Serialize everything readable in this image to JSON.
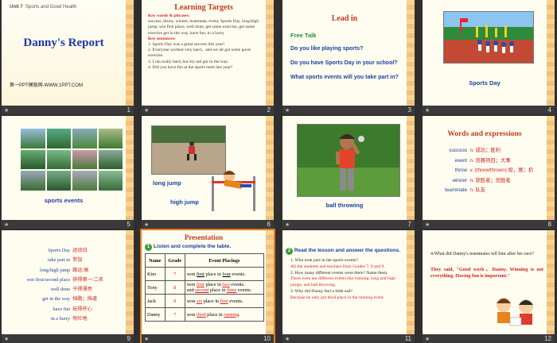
{
  "slides": {
    "s1": {
      "unit": "Unit 7",
      "unit_sub": "Sports and Good Health",
      "title": "Danny's Report",
      "credit": "第一PPT模板网-WWW.1PPT.COM",
      "num": "1"
    },
    "s2": {
      "title": "Learning Targets",
      "kw_label": "Key words & phrases:",
      "kw": "success, throw, winner, teammate, event, Sports Day, long/high jump, win first place, well done, get some exercise, get some exercise get in the way, have fun, in a hurry",
      "ks_label": "Key sentences:",
      "ks": [
        "1. Sports Day was a great success this year!",
        "2. Everyone worked very hard，and we all got some good exercise.",
        "3. I ran really hard, but my tail got in the way.",
        "4. Did you have fun at the sports meet last year?"
      ],
      "num": "2"
    },
    "s3": {
      "title": "Lead in",
      "free": "Free Talk",
      "q1": "Do you like playing sports?",
      "q2": "Do you have Sports Day in your school?",
      "q3": "What  sports events will you take part in?",
      "num": "3"
    },
    "s4": {
      "caption": "Sports  Day",
      "num": "4"
    },
    "s5": {
      "caption": "sports events",
      "num": "5"
    },
    "s6": {
      "c1": "long jump",
      "c2": "high jump",
      "num": "6"
    },
    "s7": {
      "caption": "ball throwing",
      "num": "7"
    },
    "s8": {
      "title": "Words and expressions",
      "rows": [
        {
          "en": "success",
          "zh": "n. 成功；胜利"
        },
        {
          "en": "event",
          "zh": "n. 竞赛项目；大事"
        },
        {
          "en": "throw",
          "zh": "v. (threw/thrown) 投，掷；扔"
        },
        {
          "en": "winner",
          "zh": "n. 获胜者；优胜者"
        },
        {
          "en": "teammate",
          "zh": "n. 队友"
        }
      ],
      "num": "8"
    },
    "s9": {
      "rows": [
        {
          "en": "Sports Day",
          "zh": "运动日"
        },
        {
          "en": "take part in",
          "zh": "参加"
        },
        {
          "en": "long/high jump",
          "zh": "跳远/高"
        },
        {
          "en": "win first/second place",
          "zh": "获得第一/二名"
        },
        {
          "en": "well done",
          "zh": "干得漂亮"
        },
        {
          "en": "get in the way",
          "zh": "挡路；挡道"
        },
        {
          "en": "have fun",
          "zh": "玩得开心"
        },
        {
          "en": "in a hurry",
          "zh": "匆忙地"
        }
      ],
      "num": "9"
    },
    "s10": {
      "title": "Presentation",
      "badge": "1",
      "instruction": "Listen and complete the table.",
      "headers": [
        "Name",
        "Grade",
        "Event Placings"
      ],
      "rows": [
        {
          "name": "Kim",
          "grade": "7",
          "l1": "won",
          "u1": "first",
          "l2": "place in",
          "u2": "four",
          "l3": "events."
        },
        {
          "name": "Tony",
          "grade": "8",
          "l1": "won",
          "u1": "first",
          "l2": "place in",
          "u2": "two",
          "l3": "events.",
          "m1": "and",
          "u3": "second",
          "m2": "place in",
          "u4": "three",
          "m3": "events."
        },
        {
          "name": "Jack",
          "grade": "9",
          "l1": "won",
          "u1": "six",
          "l2": "place in",
          "u2": "first",
          "l3": "events."
        },
        {
          "name": "Danny",
          "grade": "7",
          "l1": "won",
          "u1": "third",
          "l2": "place in",
          "u2": "running",
          "l3": "."
        }
      ],
      "num": "10"
    },
    "s11": {
      "badge": "2",
      "instruction": "Read the lesson and answer the questions.",
      "q1": "1. Who took part in the sports events?",
      "a1": "All the students and teachers from Grades 7, 8 and 9.",
      "q2": "2. How many different events were there? Name them.",
      "a2": "There were ten different events like running, long and high jumps, and ball throwing.",
      "q3": "3. Why did Danny feel a little sad?",
      "a3": "Because he only got third place in the running event.",
      "num": "11"
    },
    "s12": {
      "q": "4.What did Danny's teammates tell him after his race?",
      "a": "They said, \"Good work，Danny. Winning is not everything. Having fun is important.\"",
      "num": "12"
    }
  },
  "colors": {
    "accent": "#c23b1e",
    "blue": "#1b3fa0",
    "red": "#d42020",
    "selection": "#e07a1f"
  }
}
